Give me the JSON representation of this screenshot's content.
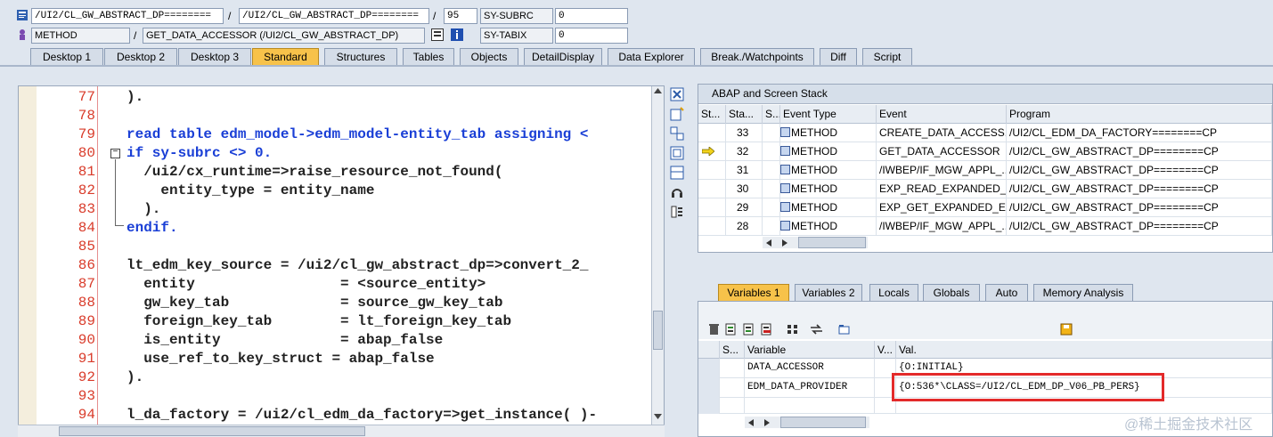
{
  "header": {
    "row1": {
      "field1": "/UI2/CL_GW_ABSTRACT_DP========",
      "slash1": "/",
      "field2": "/UI2/CL_GW_ABSTRACT_DP========",
      "slash2": "/",
      "line": "95",
      "var_name": "SY-SUBRC",
      "var_value": "0"
    },
    "row2": {
      "type": "METHOD",
      "slash": "/",
      "name": "GET_DATA_ACCESSOR (/UI2/CL_GW_ABSTRACT_DP)",
      "var_name": "SY-TABIX",
      "var_value": "0"
    }
  },
  "tabs": [
    "Desktop 1",
    "Desktop 2",
    "Desktop 3",
    "Standard",
    "Structures",
    "Tables",
    "Objects",
    "DetailDisplay",
    "Data Explorer",
    "Break./Watchpoints",
    "Diff",
    "Script"
  ],
  "active_tab": "Standard",
  "editor": {
    "lines": [
      {
        "num": "77",
        "code": ")."
      },
      {
        "num": "78",
        "code": ""
      },
      {
        "num": "79",
        "code": "read table edm_model->edm_model-entity_tab assigning <"
      },
      {
        "num": "80",
        "code": "if sy-subrc <> 0."
      },
      {
        "num": "81",
        "code": "  /ui2/cx_runtime=>raise_resource_not_found("
      },
      {
        "num": "82",
        "code": "    entity_type = entity_name"
      },
      {
        "num": "83",
        "code": "  )."
      },
      {
        "num": "84",
        "code": "endif."
      },
      {
        "num": "85",
        "code": ""
      },
      {
        "num": "86",
        "code": "lt_edm_key_source = /ui2/cl_gw_abstract_dp=>convert_2_"
      },
      {
        "num": "87",
        "code": "  entity                 = <source_entity>"
      },
      {
        "num": "88",
        "code": "  gw_key_tab             = source_gw_key_tab"
      },
      {
        "num": "89",
        "code": "  foreign_key_tab        = lt_foreign_key_tab"
      },
      {
        "num": "90",
        "code": "  is_entity              = abap_false"
      },
      {
        "num": "91",
        "code": "  use_ref_to_key_struct = abap_false"
      },
      {
        "num": "92",
        "code": ")."
      },
      {
        "num": "93",
        "code": ""
      },
      {
        "num": "94",
        "code": "l_da_factory = /ui2/cl_edm_da_factory=>get_instance( )-"
      }
    ]
  },
  "stack": {
    "title": "ABAP and Screen Stack",
    "columns": [
      "St...",
      "Sta...",
      "S...",
      "Event Type",
      "Event",
      "Program"
    ],
    "rows": [
      {
        "level": "33",
        "type": "METHOD",
        "event": "CREATE_DATA_ACCESS...",
        "program": "/UI2/CL_EDM_DA_FACTORY========CP",
        "current": false
      },
      {
        "level": "32",
        "type": "METHOD",
        "event": "GET_DATA_ACCESSOR",
        "program": "/UI2/CL_GW_ABSTRACT_DP========CP",
        "current": true
      },
      {
        "level": "31",
        "type": "METHOD",
        "event": "/IWBEP/IF_MGW_APPL_...",
        "program": "/UI2/CL_GW_ABSTRACT_DP========CP",
        "current": false
      },
      {
        "level": "30",
        "type": "METHOD",
        "event": "EXP_READ_EXPANDED_...",
        "program": "/UI2/CL_GW_ABSTRACT_DP========CP",
        "current": false
      },
      {
        "level": "29",
        "type": "METHOD",
        "event": "EXP_GET_EXPANDED_E...",
        "program": "/UI2/CL_GW_ABSTRACT_DP========CP",
        "current": false
      },
      {
        "level": "28",
        "type": "METHOD",
        "event": "/IWBEP/IF_MGW_APPL_...",
        "program": "/UI2/CL_GW_ABSTRACT_DP========CP",
        "current": false
      }
    ]
  },
  "var_tabs": [
    "Variables 1",
    "Variables 2",
    "Locals",
    "Globals",
    "Auto",
    "Memory Analysis"
  ],
  "active_var_tab": "Variables 1",
  "variables": {
    "columns": [
      "S...",
      "Variable",
      "V...",
      "Val."
    ],
    "rows": [
      {
        "name": "DATA_ACCESSOR",
        "value": "{O:INITIAL}"
      },
      {
        "name": "EDM_DATA_PROVIDER",
        "value": "{O:536*\\CLASS=/UI2/CL_EDM_DP_V06_PB_PERS}"
      },
      {
        "name": "",
        "value": ""
      }
    ]
  },
  "watermark": "@稀土掘金技术社区",
  "colors": {
    "active_tab": "#f7c24a",
    "line_numbers": "#d93b2a",
    "keyword": "#1a3fd6",
    "highlight_box": "#e32a2a"
  }
}
